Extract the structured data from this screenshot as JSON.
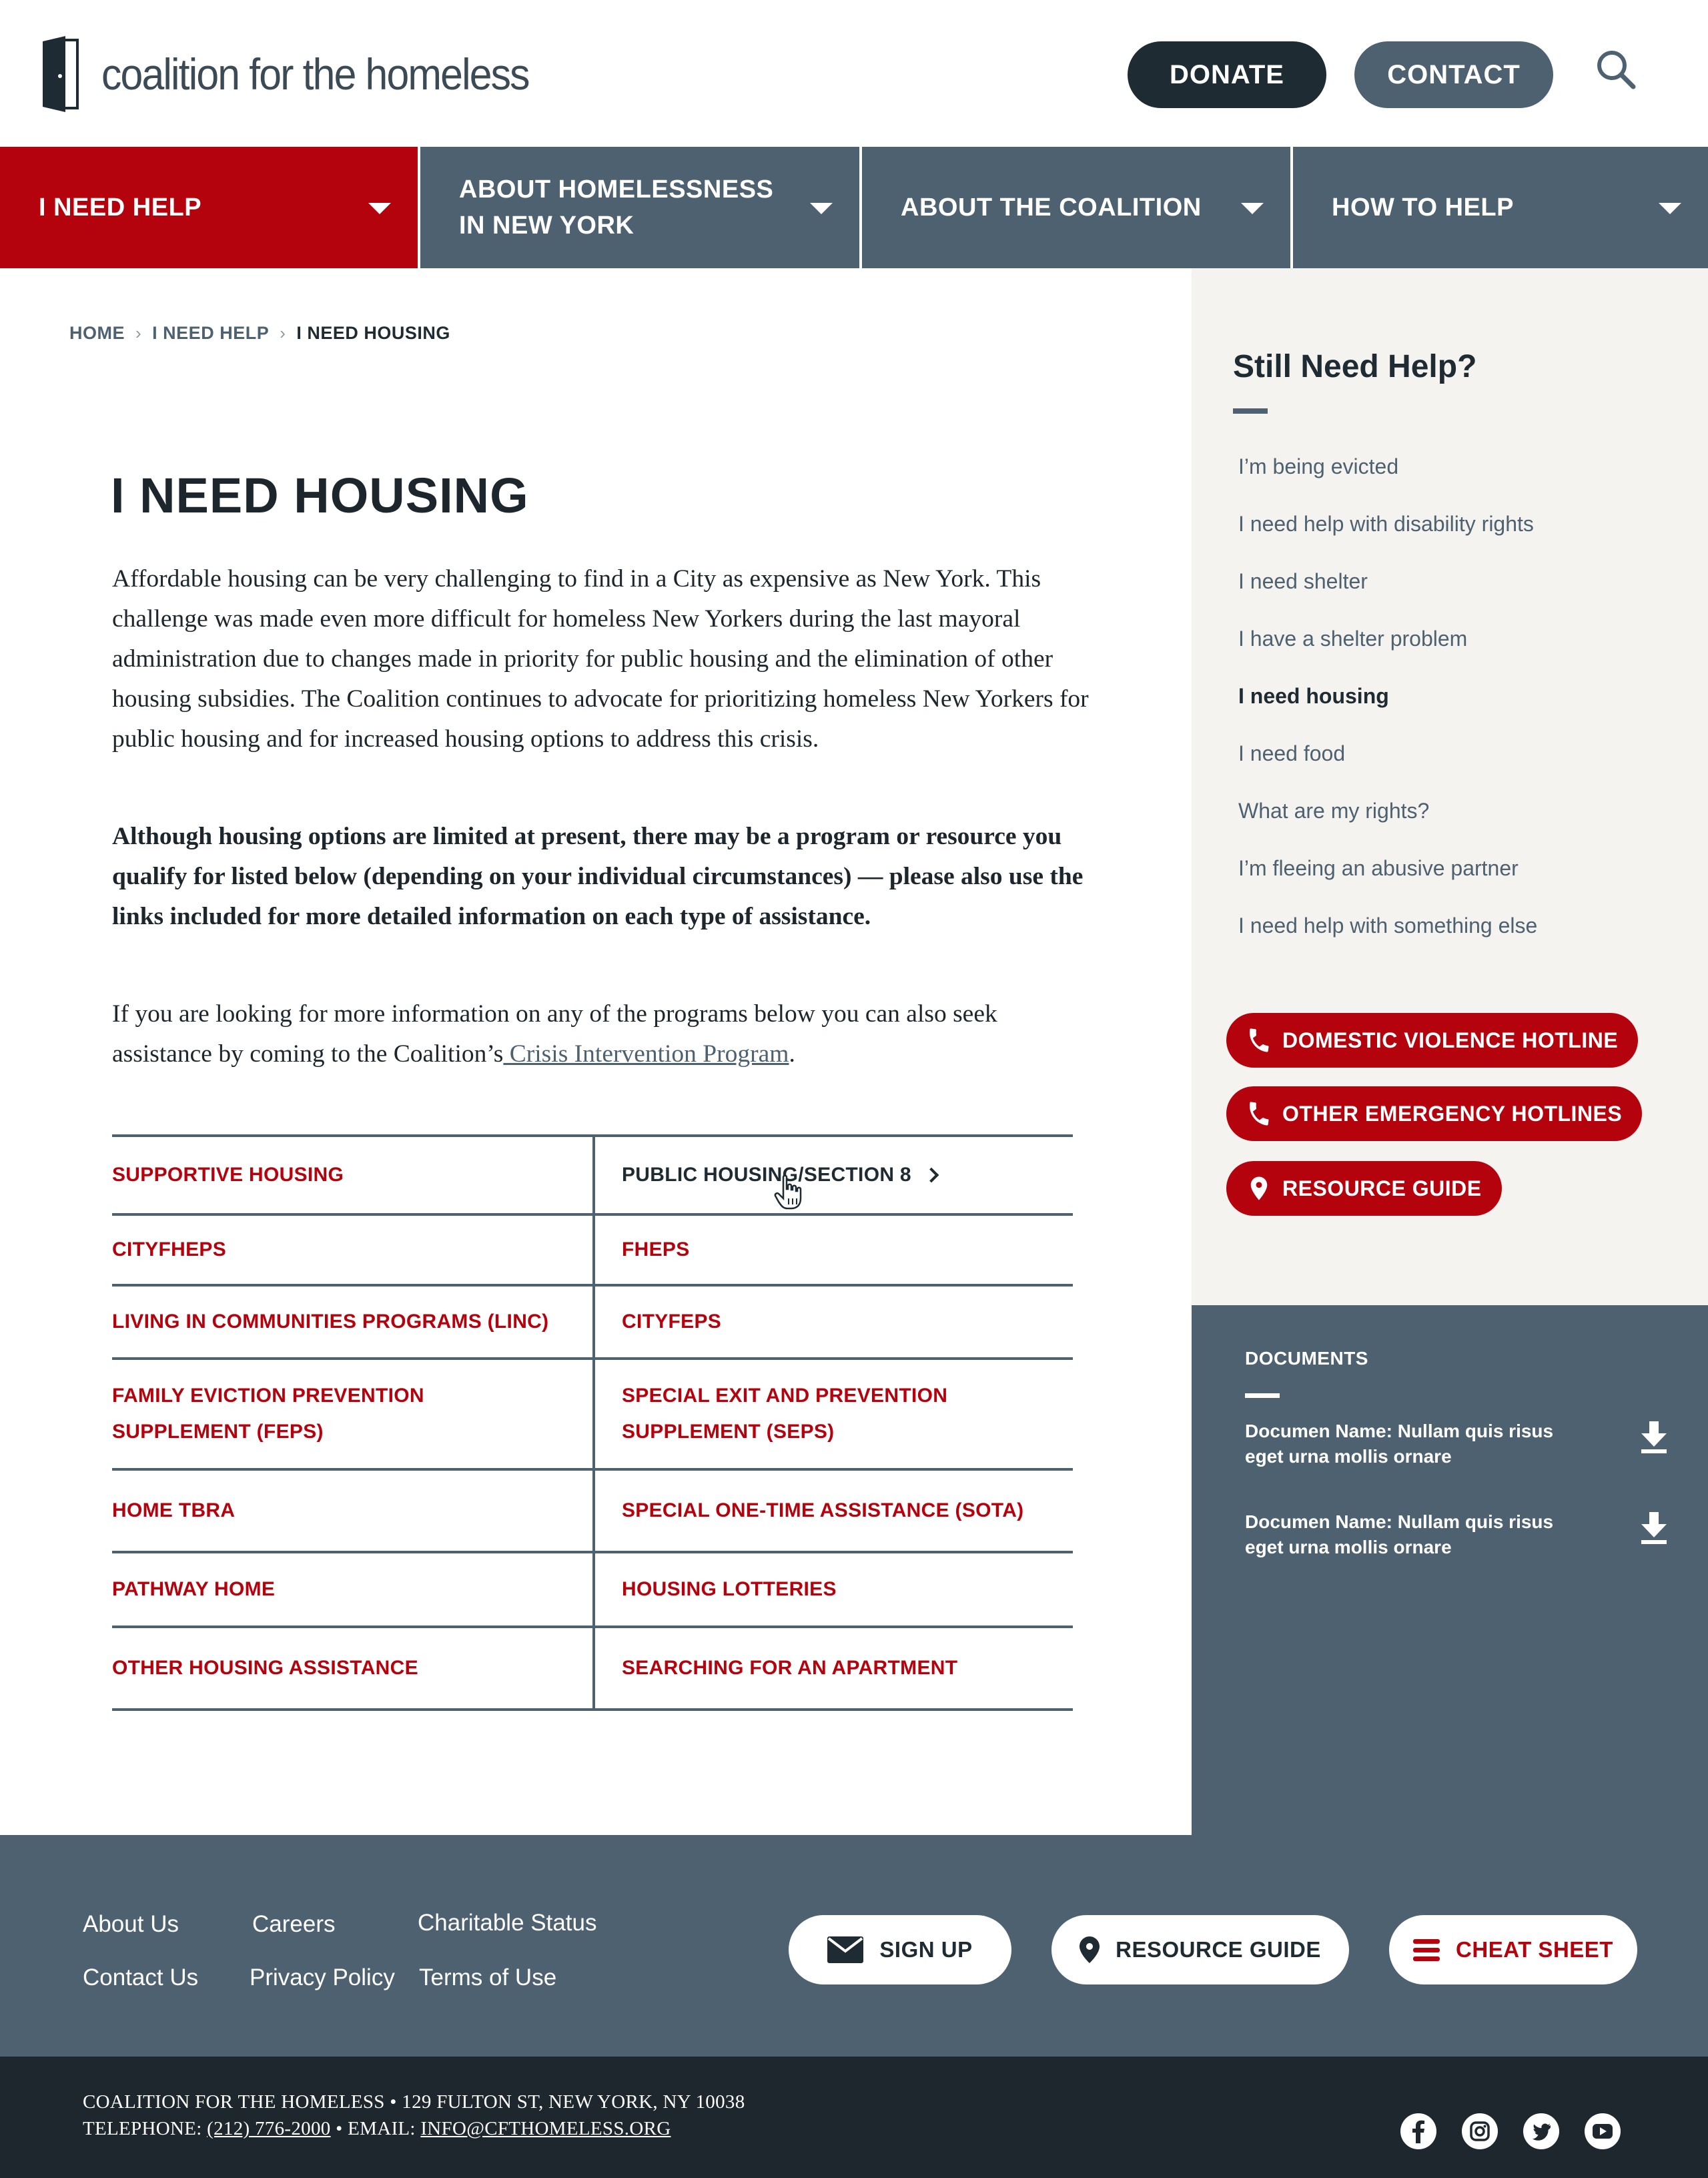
{
  "header": {
    "logo_text": "coalition for the homeless",
    "donate_label": "DONATE",
    "contact_label": "CONTACT",
    "search_icon": "search-icon"
  },
  "nav": {
    "items": [
      {
        "label": "I NEED HELP",
        "active": true
      },
      {
        "label": "ABOUT HOMELESSNESS\nIN NEW YORK",
        "active": false
      },
      {
        "label": "ABOUT THE COALITION",
        "active": false
      },
      {
        "label": "HOW TO HELP",
        "active": false
      }
    ]
  },
  "breadcrumb": [
    "HOME",
    "I NEED HELP",
    "I NEED HOUSING"
  ],
  "main": {
    "title": "I NEED HOUSING",
    "paragraph1": "Affordable housing can be very challenging to find in a City as expensive as New York. This challenge was made even more difficult for homeless New Yorkers during the last mayoral administration due to changes made in priority for public housing and the elimination of other housing subsidies. The Coalition continues to advocate for prioritizing homeless New Yorkers for public housing and for increased housing options to address this crisis.",
    "paragraph2": "Although housing options are limited at present, there may be a program or resource you qualify for listed below (depending on your individual circumstances) — please also use the links included for more detailed information on each type of assistance.",
    "paragraph3_prefix": "If you are looking for more information on any of the programs below you can also seek assistance by coming to the Coalition’s",
    "paragraph3_link": " Crisis Intervention Program",
    "paragraph3_suffix": ".",
    "programs": [
      [
        "SUPPORTIVE HOUSING",
        "PUBLIC HOUSING/SECTION 8"
      ],
      [
        "CITYFHEPS",
        "FHEPS"
      ],
      [
        "LIVING IN COMMUNITIES PROGRAMS (LINC)",
        "CITYFEPS"
      ],
      [
        "FAMILY EVICTION PREVENTION\nSUPPLEMENT (FEPS)",
        "SPECIAL EXIT AND PREVENTION\nSUPPLEMENT (SEPS)"
      ],
      [
        "HOME TBRA",
        "SPECIAL ONE-TIME ASSISTANCE (SOTA)"
      ],
      [
        "PATHWAY HOME",
        "HOUSING LOTTERIES"
      ],
      [
        "OTHER HOUSING ASSISTANCE",
        "SEARCHING FOR AN APARTMENT"
      ]
    ]
  },
  "sidebar": {
    "title": "Still Need Help?",
    "links": [
      "I’m being evicted",
      "I need help with disability rights",
      "I need shelter",
      "I have a shelter problem",
      "I need housing",
      "I need food",
      "What are my rights?",
      "I’m fleeing an abusive partner",
      "I need help with something else"
    ],
    "current_index": 4,
    "buttons": {
      "dv_hotline": "DOMESTIC VIOLENCE HOTLINE",
      "other_hotlines": "OTHER EMERGENCY HOTLINES",
      "resource_guide": "RESOURCE GUIDE"
    }
  },
  "documents": {
    "title": "DOCUMENTS",
    "items": [
      "Documen Name: Nullam quis risus eget urna mollis ornare",
      "Documen Name: Nullam quis risus eget urna mollis ornare"
    ]
  },
  "footer": {
    "links": {
      "about": "About Us",
      "careers": "Careers",
      "charitable": "Charitable Status",
      "contact": "Contact Us",
      "privacy": "Privacy Policy",
      "terms": "Terms of Use"
    },
    "signup_label": "SIGN UP",
    "resource_guide_label": "RESOURCE GUIDE",
    "cheat_sheet_label": "CHEAT SHEET",
    "address_line": "COALITION FOR THE HOMELESS • 129 FULTON ST, NEW YORK, NY 10038",
    "telephone_label": "TELEPHONE: ",
    "telephone": "(212) 776-2000",
    "email_label": " • EMAIL: ",
    "email": "INFO@CFTHOMELESS.ORG",
    "social_icons": [
      "facebook-icon",
      "instagram-icon",
      "twitter-icon",
      "youtube-icon"
    ]
  },
  "colors": {
    "brand_red": "#b5030e",
    "slate": "#4e6170",
    "dark": "#1e2b33",
    "sidebar_bg": "#f5f3ef"
  }
}
